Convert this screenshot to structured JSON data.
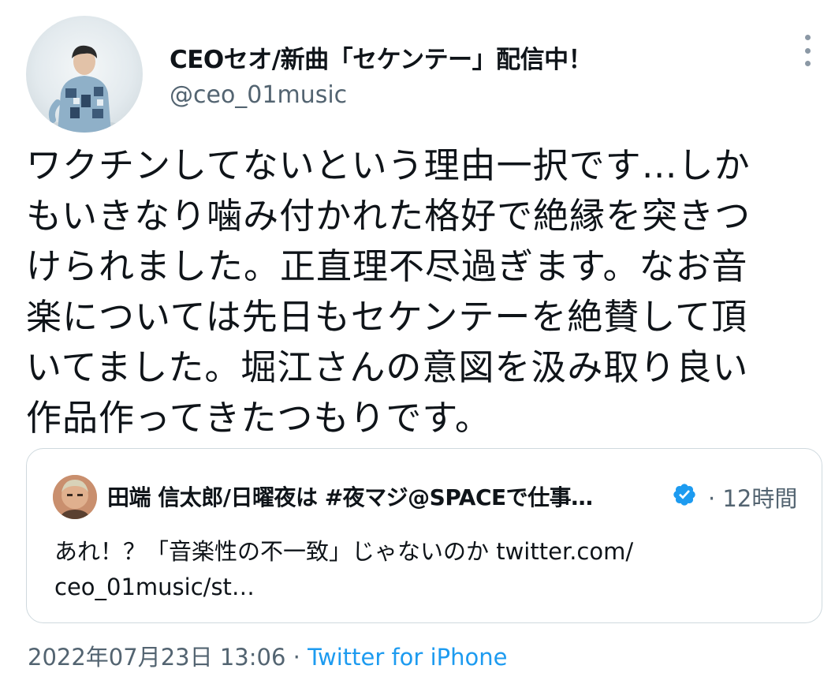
{
  "author": {
    "display_name": "CEOセオ/新曲「セケンテー」配信中！",
    "handle": "@ceo_01music"
  },
  "tweet": {
    "lines": [
      "ワクチンしてないという理由一択です…しか",
      "もいきなり噛み付かれた格好で絶縁を突きつ",
      "けられました。正直理不尽過ぎます。なお音",
      "楽については先日もセケンテーを絶賛して頂",
      "いてました。堀江さんの意図を汲み取り良い",
      "作品作ってきたつもりです。"
    ]
  },
  "quoted_tweet": {
    "display_name": "田端 信太郎/日曜夜は #夜マジ@SPACEで仕事…",
    "time": "· 12時間",
    "lines": [
      "あれ！？「音楽性の不一致」じゃないのか twitter.com/",
      "ceo_01music/st…"
    ]
  },
  "meta": {
    "timestamp": "2022年07月23日 13:06",
    "separator": " · ",
    "source": "Twitter for iPhone"
  },
  "icons": {
    "more": "more-vertical-icon",
    "verified": "verified-badge-icon"
  },
  "colors": {
    "text": "#0f1419",
    "secondary": "#536471",
    "link": "#1d9bf0",
    "border": "#cfd9de"
  }
}
